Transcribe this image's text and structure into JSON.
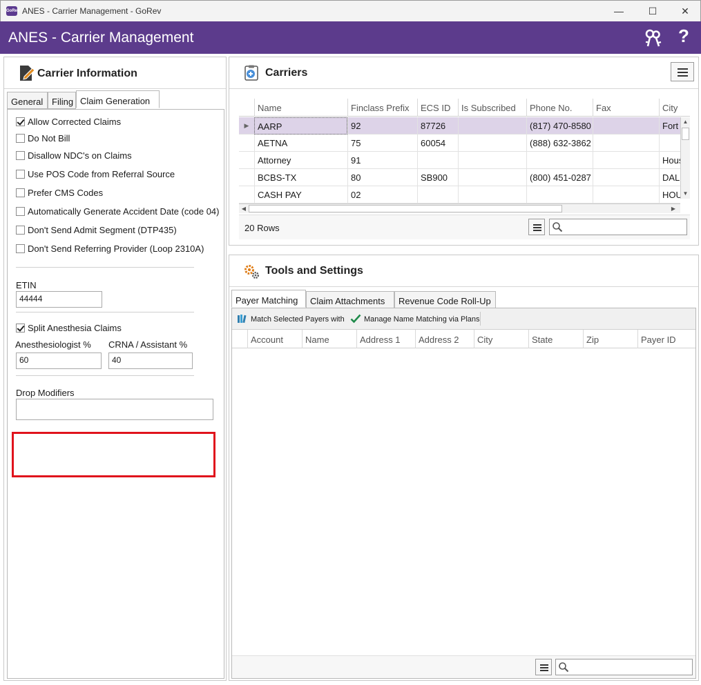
{
  "window": {
    "logo_text": "GoRev",
    "title": "ANES - Carrier Management - GoRev",
    "minimize": "—",
    "maximize": "☐",
    "close": "✕"
  },
  "header": {
    "title": "ANES - Carrier Management",
    "help_label": "?",
    "color": "#5c3b8c"
  },
  "carrier_info": {
    "title": "Carrier Information",
    "tabs": [
      "General",
      "Filing",
      "Claim Generation"
    ],
    "active_tab": "Claim Generation",
    "options": [
      {
        "label": "Allow Corrected Claims",
        "checked": true
      },
      {
        "label": "Do Not Bill",
        "checked": false
      },
      {
        "label": "Disallow NDC's on Claims",
        "checked": false
      },
      {
        "label": "Use POS Code from Referral Source",
        "checked": false
      },
      {
        "label": "Prefer CMS Codes",
        "checked": false
      },
      {
        "label": "Automatically Generate Accident Date (code 04)",
        "checked": false
      },
      {
        "label": "Don't Send Admit Segment (DTP435)",
        "checked": false
      },
      {
        "label": "Don't Send Referring Provider (Loop 2310A)",
        "checked": false
      }
    ],
    "etin_label": "ETIN",
    "etin_value": "44444",
    "split_label": "Split Anesthesia Claims",
    "split_checked": true,
    "anesthesiologist_label": "Anesthesiologist %",
    "anesthesiologist_value": "60",
    "crna_label": "CRNA / Assistant %",
    "crna_value": "40",
    "drop_modifiers_label": "Drop Modifiers",
    "drop_modifiers_value": ""
  },
  "carriers": {
    "title": "Carriers",
    "columns": [
      "Name",
      "Finclass Prefix",
      "ECS ID",
      "Is Subscribed",
      "Phone No.",
      "Fax",
      "City"
    ],
    "rows": [
      [
        "AARP",
        "92",
        "87726",
        "",
        "(817) 470-8580",
        "",
        "Fort Worth"
      ],
      [
        "AETNA",
        "75",
        "60054",
        "",
        "(888) 632-3862",
        "",
        ""
      ],
      [
        "Attorney",
        "91",
        "",
        "",
        "",
        "",
        "Houston"
      ],
      [
        "BCBS-TX",
        "80",
        "SB900",
        "",
        "(800) 451-0287",
        "",
        "DALLAS"
      ],
      [
        "CASH PAY",
        "02",
        "",
        "",
        "",
        "",
        "HOUSTON"
      ]
    ],
    "selected_row": 0,
    "row_count": "20 Rows",
    "search_value": ""
  },
  "tools": {
    "title": "Tools and Settings",
    "tabs": [
      "Payer Matching",
      "Claim Attachments",
      "Revenue Code Roll-Up"
    ],
    "active_tab": "Payer Matching",
    "match_button": "Match Selected Payers with",
    "manage_button": "Manage Name Matching via Plans",
    "columns": [
      "Account",
      "Name",
      "Address 1",
      "Address 2",
      "City",
      "State",
      "Zip",
      "Payer ID"
    ],
    "search_value": ""
  }
}
